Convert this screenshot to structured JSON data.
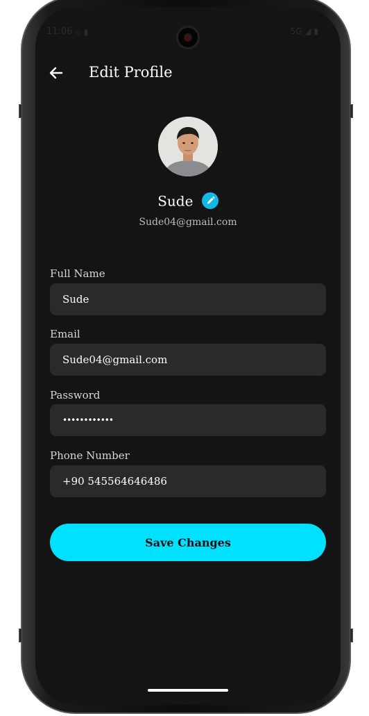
{
  "status_bar": {
    "time": "11:06",
    "left_icons": "⦸ ▮",
    "network": "5G",
    "right_icons": "◢ ▮"
  },
  "header": {
    "title": "Edit Profile",
    "back_icon": "arrow-left-icon"
  },
  "profile": {
    "name": "Sude",
    "email": "Sude04@gmail.com",
    "edit_icon": "pencil-icon",
    "badge_color": "#13b8e6"
  },
  "form": {
    "full_name": {
      "label": "Full Name",
      "value": "Sude"
    },
    "email": {
      "label": "Email",
      "value": "Sude04@gmail.com"
    },
    "password": {
      "label": "Password",
      "value": "••••••••••••"
    },
    "phone": {
      "label": "Phone Number",
      "value": "+90 545564646486"
    }
  },
  "actions": {
    "save_label": "Save Changes",
    "accent_color": "#00e1ff"
  },
  "theme": {
    "background": "#141414",
    "field_background": "#2a2a2a"
  }
}
